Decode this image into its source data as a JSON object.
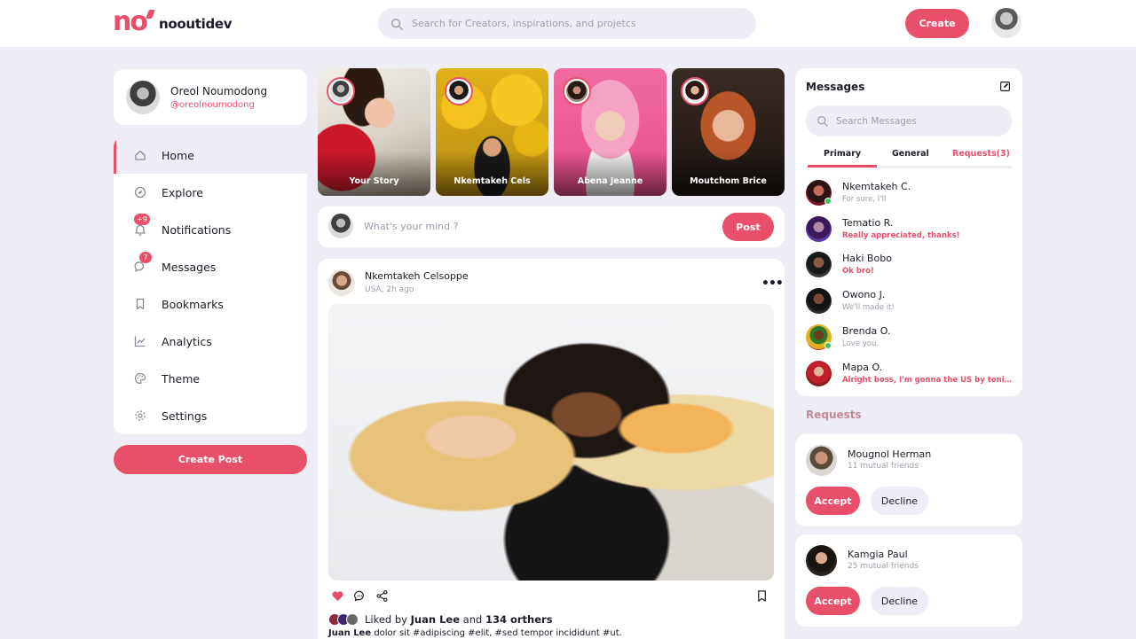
{
  "brand": {
    "name": "nooutidev",
    "accent": "#e8506a",
    "background": "#eeedf6"
  },
  "topbar": {
    "search_placeholder": "Search for Creators, inspirations, and projetcs",
    "create_label": "Create"
  },
  "profile": {
    "name": "Oreol Noumodong",
    "handle": "@oreolnoumodong"
  },
  "nav": {
    "items": [
      {
        "label": "Home",
        "icon": "home-icon",
        "active": true
      },
      {
        "label": "Explore",
        "icon": "compass-icon"
      },
      {
        "label": "Notifications",
        "icon": "bell-icon",
        "badge": "+9"
      },
      {
        "label": "Messages",
        "icon": "chat-icon",
        "badge": "7"
      },
      {
        "label": "Bookmarks",
        "icon": "bookmark-icon"
      },
      {
        "label": "Analytics",
        "icon": "chart-icon"
      },
      {
        "label": "Theme",
        "icon": "palette-icon"
      },
      {
        "label": "Settings",
        "icon": "gear-icon"
      }
    ],
    "create_post_label": "Create Post"
  },
  "stories": [
    {
      "label": "Your Story"
    },
    {
      "label": "Nkemtakeh Cels"
    },
    {
      "label": "Abena Jeanne"
    },
    {
      "label": "Moutchom Brice"
    }
  ],
  "composer": {
    "placeholder": "What's your mind ?",
    "post_label": "Post"
  },
  "feed": {
    "author": "Nkemtakeh Celsoppe",
    "meta": "USA, 2h ago",
    "liked_prefix": "Liked by",
    "liked_name": "Juan Lee",
    "liked_and": "and",
    "liked_count": "134 orthers",
    "caption_author": "Juan Lee",
    "caption_text": "dolor sit #adipiscing #elit, #sed tempor incididunt #ut."
  },
  "messages": {
    "title": "Messages",
    "search_placeholder": "Search Messages",
    "tabs": [
      "Primary",
      "General",
      "Requests(3)"
    ],
    "items": [
      {
        "name": "Nkemtakeh C.",
        "text": "For sure, I'll",
        "unread": false
      },
      {
        "name": "Tematio R.",
        "text": "Really appreciated, thanks!",
        "unread": true
      },
      {
        "name": "Haki Bobo",
        "text": "Ok bro!",
        "unread": true
      },
      {
        "name": "Owono J.",
        "text": "We'll made it!",
        "unread": false
      },
      {
        "name": "Brenda O.",
        "text": "Love you.",
        "unread": false
      },
      {
        "name": "Mapa O.",
        "text": "Alright boss, I'm gonna the US by tonight.",
        "unread": true
      }
    ]
  },
  "requests": {
    "title": "Requests",
    "accept_label": "Accept",
    "decline_label": "Decline",
    "items": [
      {
        "name": "Mougnol Herman",
        "mutual": "11 mutual friends"
      },
      {
        "name": "Kamgia Paul",
        "mutual": "25 mutual friends"
      }
    ]
  }
}
